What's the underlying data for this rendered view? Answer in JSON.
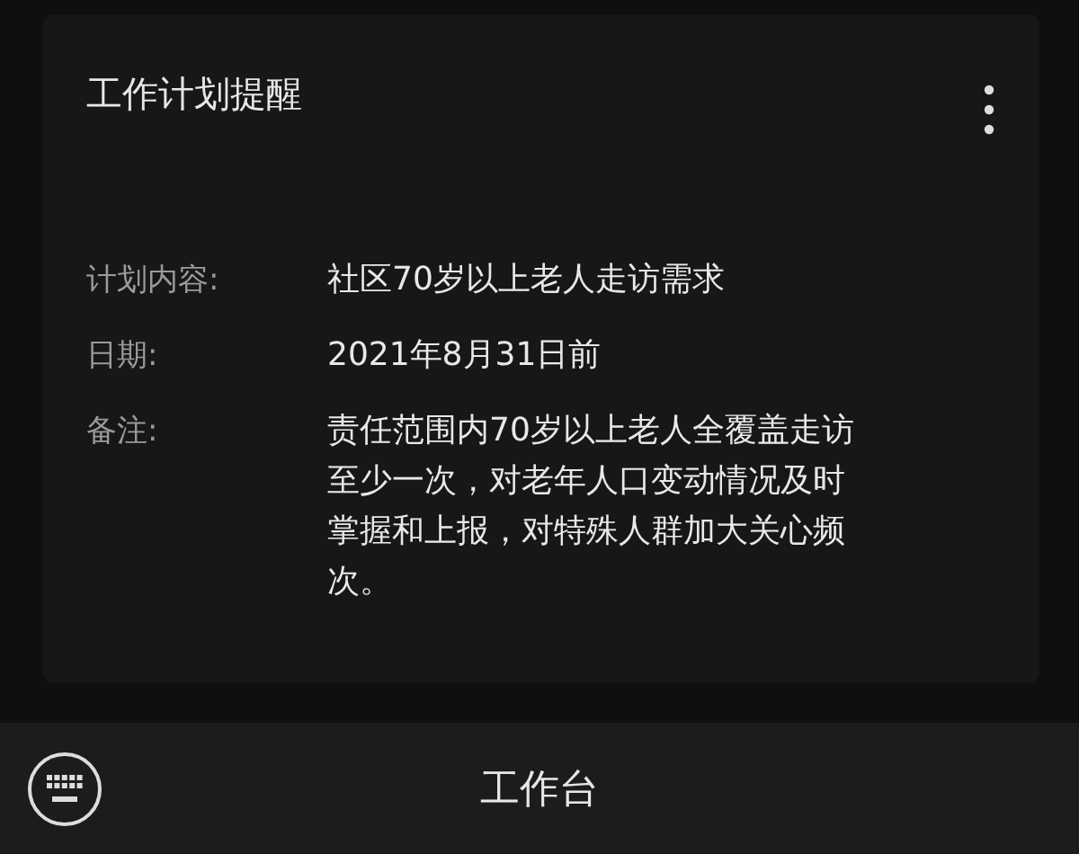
{
  "card": {
    "title": "工作计划提醒",
    "fields": [
      {
        "label": "计划内容:",
        "value": "社区70岁以上老人走访需求"
      },
      {
        "label": "日期:",
        "value": "2021年8月31日前"
      },
      {
        "label": "备注:",
        "value": "责任范围内70岁以上老人全覆盖走访至少一次，对老年人口变动情况及时掌握和上报，对特殊人群加大关心频次。"
      }
    ]
  },
  "bottom_bar": {
    "title": "工作台"
  }
}
